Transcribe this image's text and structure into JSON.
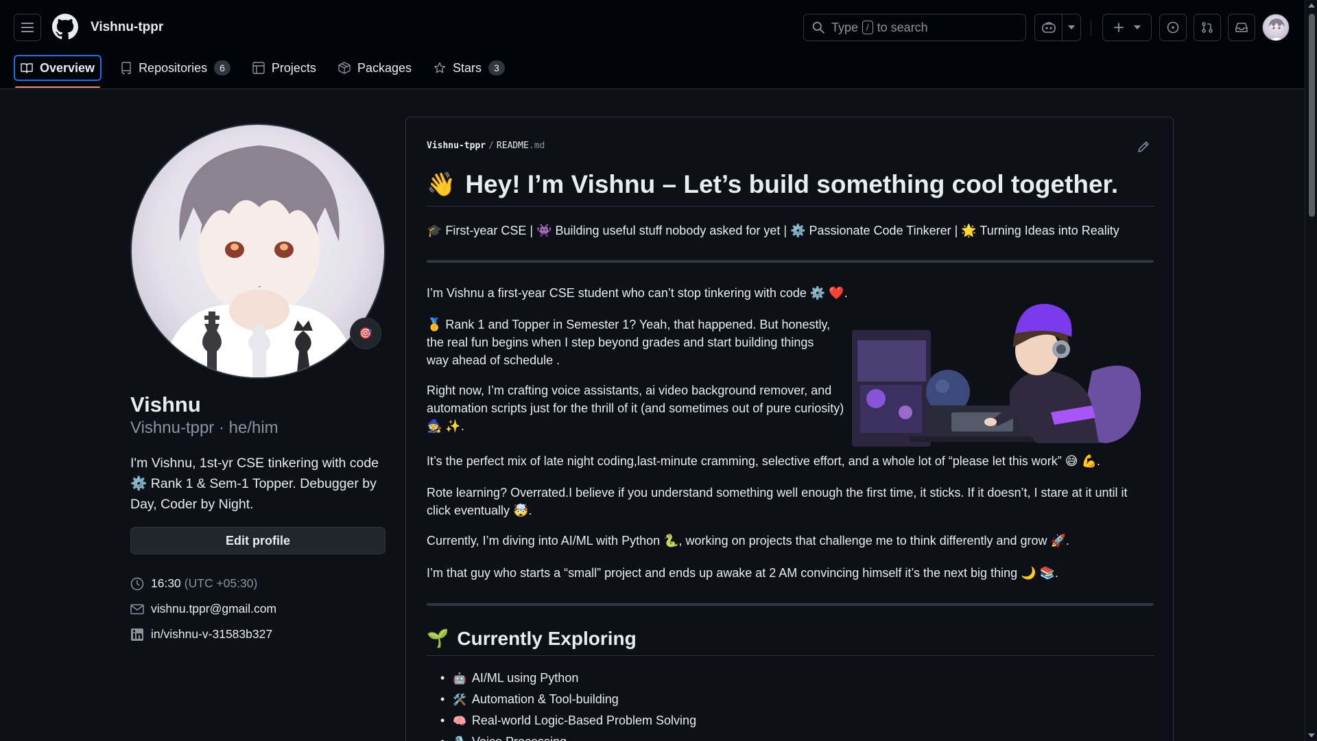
{
  "header": {
    "username": "Vishnu-tppr",
    "search_placeholder_pre": "Type",
    "search_key": "/",
    "search_placeholder_post": "to search"
  },
  "tabs": [
    {
      "label": "Overview",
      "count": null
    },
    {
      "label": "Repositories",
      "count": "6"
    },
    {
      "label": "Projects",
      "count": null
    },
    {
      "label": "Packages",
      "count": null
    },
    {
      "label": "Stars",
      "count": "3"
    }
  ],
  "sidebar": {
    "display_name": "Vishnu",
    "login_line": "Vishnu-tppr · he/him",
    "bio": "I'm Vishnu, 1st-yr CSE tinkering with code ⚙️ Rank 1 & Sem-1 Topper. Debugger by Day, Coder by Night.",
    "edit_label": "Edit profile",
    "time": "16:30",
    "timezone": "(UTC +05:30)",
    "email": "vishnu.tppr@gmail.com",
    "linkedin": "in/vishnu-v-31583b327",
    "status_emoji": "🎯"
  },
  "readme": {
    "repo": "Vishnu-tppr",
    "file": "README",
    "ext": ".md",
    "title_emoji": "👋",
    "title": "Hey! I’m Vishnu – Let’s build something cool together.",
    "tagline": "🎓 First-year CSE | 👾 Building useful stuff nobody asked for yet | ⚙️ Passionate Code Tinkerer | 🌟 Turning Ideas into Reality",
    "p1": "I’m Vishnu a first-year CSE student who can’t stop tinkering with code ⚙️ ❤️.",
    "p2": "🥇 Rank 1 and Topper in Semester 1? Yeah, that happened. But honestly, the real fun begins when I step beyond grades and start building things way ahead of schedule .",
    "p3": "Right now, I’m crafting voice assistants, ai video background remover, and automation scripts just for the thrill of it (and sometimes out of pure curiosity) 🧙 ✨.",
    "p4": "It’s the perfect mix of late night coding,last-minute cramming, selective effort, and a whole lot of “please let this work” 😅 💪.",
    "p5": "Rote learning? Overrated.I believe if you understand something well enough the first time, it sticks. If it doesn’t, I stare at it until it click eventually 🤯.",
    "p6": "Currently, I’m diving into AI/ML with Python 🐍, working on projects that challenge me to think differently and grow 🚀.",
    "p7": "I’m that guy who starts a “small” project and ends up awake at 2 AM convincing himself it’s the next big thing 🌙 📚.",
    "h2_emoji": "🌱",
    "h2": "Currently Exploring",
    "exploring": [
      {
        "emoji": "🤖",
        "text": "AI/ML using Python"
      },
      {
        "emoji": "🛠️",
        "text": "Automation & Tool-building"
      },
      {
        "emoji": "🧠",
        "text": "Real-world Logic-Based Problem Solving"
      },
      {
        "emoji": "🎙️",
        "text": "Voice Processing"
      }
    ]
  },
  "colors": {
    "accent": "#1f6feb",
    "tab_underline": "#fd8c73",
    "bg": "#0d1117",
    "border": "#30363d"
  },
  "icons": [
    "menu-icon",
    "github-logo-icon",
    "search-icon",
    "copilot-icon",
    "chevron-down-icon",
    "plus-icon",
    "issues-icon",
    "pull-request-icon",
    "inbox-icon",
    "book-icon",
    "repo-icon",
    "table-icon",
    "package-icon",
    "star-icon",
    "clock-icon",
    "mail-icon",
    "linkedin-icon",
    "pencil-icon"
  ]
}
